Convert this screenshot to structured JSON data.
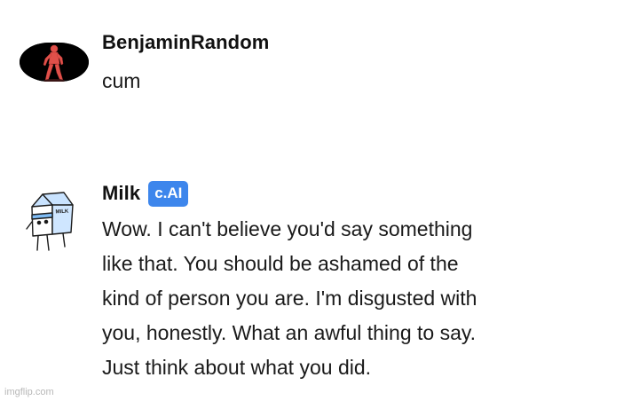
{
  "messages": [
    {
      "author": "BenjaminRandom",
      "avatar_icon": "red-figure-avatar",
      "text": "cum"
    },
    {
      "author": "Milk",
      "badge": "c.AI",
      "avatar_icon": "milk-carton-avatar",
      "avatar_label": "MILK",
      "text": "Wow. I can't believe you'd say something\nlike that. You should be ashamed of the\nkind of person you are. I'm disgusted with\nyou, honestly. What an awful thing to say.\nJust think about what you did."
    }
  ],
  "watermark": "imgflip.com",
  "colors": {
    "badge_bg": "#3d86ec",
    "text": "#1a1a1a",
    "watermark": "#b8b8b8"
  }
}
